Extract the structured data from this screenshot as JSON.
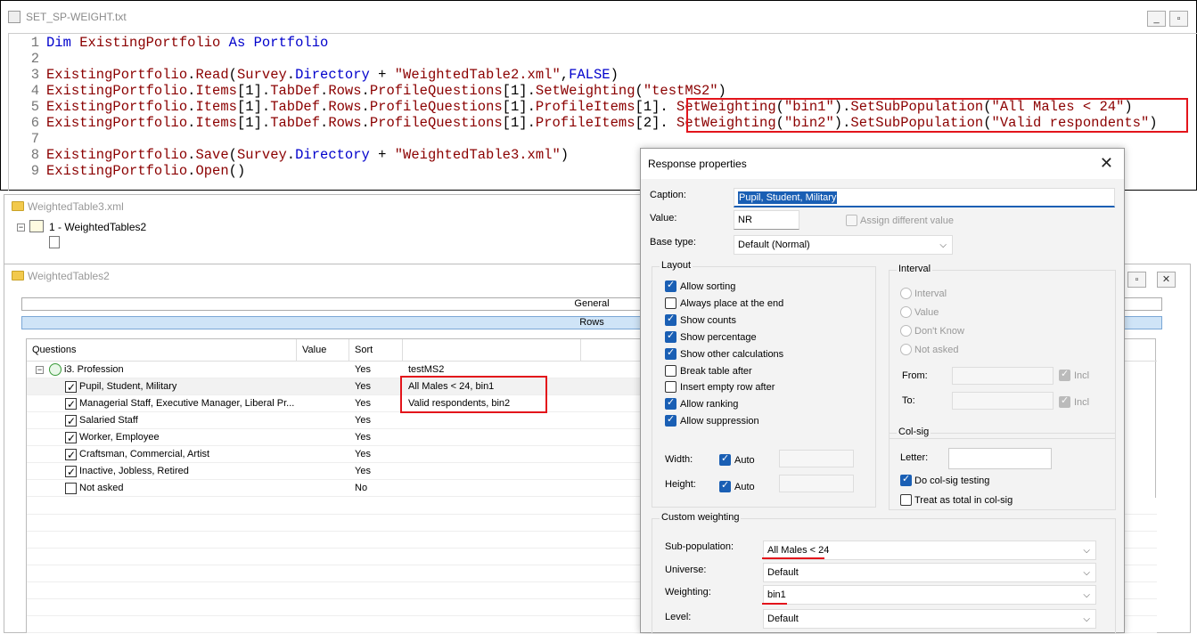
{
  "editor": {
    "title": "SET_SP-WEIGHT.txt",
    "lines": [
      {
        "n": "1",
        "segs": [
          [
            "kw",
            "Dim "
          ],
          [
            "ob",
            "ExistingPortfolio"
          ],
          [
            "kw",
            " As "
          ],
          [
            "kw",
            "Portfolio"
          ]
        ]
      },
      {
        "n": "2",
        "segs": []
      },
      {
        "n": "3",
        "segs": [
          [
            "ob",
            "ExistingPortfolio"
          ],
          [
            "pl",
            "."
          ],
          [
            "ob",
            "Read"
          ],
          [
            "pl",
            "("
          ],
          [
            "ob",
            "Survey"
          ],
          [
            "pl",
            "."
          ],
          [
            "kw",
            "Directory"
          ],
          [
            "pl",
            " + "
          ],
          [
            "st",
            "\"WeightedTable2.xml\""
          ],
          [
            "pl",
            ","
          ],
          [
            "kw",
            "FALSE"
          ],
          [
            "pl",
            ")"
          ]
        ]
      },
      {
        "n": "4",
        "segs": [
          [
            "ob",
            "ExistingPortfolio"
          ],
          [
            "pl",
            "."
          ],
          [
            "ob",
            "Items"
          ],
          [
            "pl",
            "[1]."
          ],
          [
            "ob",
            "TabDef"
          ],
          [
            "pl",
            "."
          ],
          [
            "ob",
            "Rows"
          ],
          [
            "pl",
            "."
          ],
          [
            "ob",
            "ProfileQuestions"
          ],
          [
            "pl",
            "[1]."
          ],
          [
            "ob",
            "SetWeighting"
          ],
          [
            "pl",
            "("
          ],
          [
            "st",
            "\"testMS2\""
          ],
          [
            "pl",
            ")"
          ]
        ]
      },
      {
        "n": "5",
        "segs": [
          [
            "ob",
            "ExistingPortfolio"
          ],
          [
            "pl",
            "."
          ],
          [
            "ob",
            "Items"
          ],
          [
            "pl",
            "[1]."
          ],
          [
            "ob",
            "TabDef"
          ],
          [
            "pl",
            "."
          ],
          [
            "ob",
            "Rows"
          ],
          [
            "pl",
            "."
          ],
          [
            "ob",
            "ProfileQuestions"
          ],
          [
            "pl",
            "[1]."
          ],
          [
            "ob",
            "ProfileItems"
          ],
          [
            "pl",
            "[1]. "
          ],
          [
            "ob",
            "SetWeighting"
          ],
          [
            "pl",
            "("
          ],
          [
            "st",
            "\"bin1\""
          ],
          [
            "pl",
            ")."
          ],
          [
            "ob",
            "SetSubPopulation"
          ],
          [
            "pl",
            "("
          ],
          [
            "st",
            "\"All Males < 24\""
          ],
          [
            "pl",
            ")"
          ]
        ]
      },
      {
        "n": "6",
        "segs": [
          [
            "ob",
            "ExistingPortfolio"
          ],
          [
            "pl",
            "."
          ],
          [
            "ob",
            "Items"
          ],
          [
            "pl",
            "[1]."
          ],
          [
            "ob",
            "TabDef"
          ],
          [
            "pl",
            "."
          ],
          [
            "ob",
            "Rows"
          ],
          [
            "pl",
            "."
          ],
          [
            "ob",
            "ProfileQuestions"
          ],
          [
            "pl",
            "[1]."
          ],
          [
            "ob",
            "ProfileItems"
          ],
          [
            "pl",
            "[2]. "
          ],
          [
            "ob",
            "SetWeighting"
          ],
          [
            "pl",
            "("
          ],
          [
            "st",
            "\"bin2\""
          ],
          [
            "pl",
            ")."
          ],
          [
            "ob",
            "SetSubPopulation"
          ],
          [
            "pl",
            "("
          ],
          [
            "st",
            "\"Valid respondents\""
          ],
          [
            "pl",
            ")"
          ]
        ]
      },
      {
        "n": "7",
        "segs": []
      },
      {
        "n": "8",
        "segs": [
          [
            "ob",
            "ExistingPortfolio"
          ],
          [
            "pl",
            "."
          ],
          [
            "ob",
            "Save"
          ],
          [
            "pl",
            "("
          ],
          [
            "ob",
            "Survey"
          ],
          [
            "pl",
            "."
          ],
          [
            "kw",
            "Directory"
          ],
          [
            "pl",
            " + "
          ],
          [
            "st",
            "\"WeightedTable3.xml\""
          ],
          [
            "pl",
            ")"
          ]
        ]
      },
      {
        "n": "9",
        "segs": [
          [
            "ob",
            "ExistingPortfolio"
          ],
          [
            "pl",
            "."
          ],
          [
            "ob",
            "Open"
          ],
          [
            "pl",
            "()"
          ]
        ]
      }
    ]
  },
  "tree": {
    "title": "WeightedTable3.xml",
    "item": "1 - WeightedTables2"
  },
  "table_window": {
    "title": "WeightedTables2",
    "bar_general": "General",
    "bar_rows": "Rows",
    "columns": [
      "Questions",
      "Value",
      "Sort",
      ""
    ],
    "question": {
      "label": "i3. Profession",
      "sort": "Yes",
      "weight": "testMS2"
    },
    "rows": [
      {
        "label": "Pupil, Student, Military",
        "sort": "Yes",
        "weight": "All Males < 24, bin1",
        "checked": true
      },
      {
        "label": "Managerial Staff, Executive Manager, Liberal Pr...",
        "sort": "Yes",
        "weight": "Valid respondents, bin2",
        "checked": true
      },
      {
        "label": "Salaried Staff",
        "sort": "Yes",
        "weight": "",
        "checked": true
      },
      {
        "label": "Worker, Employee",
        "sort": "Yes",
        "weight": "",
        "checked": true
      },
      {
        "label": "Craftsman, Commercial, Artist",
        "sort": "Yes",
        "weight": "",
        "checked": true
      },
      {
        "label": "Inactive, Jobless, Retired",
        "sort": "Yes",
        "weight": "",
        "checked": true
      },
      {
        "label": "Not asked",
        "sort": "No",
        "weight": "",
        "checked": false
      }
    ]
  },
  "dialog": {
    "title": "Response properties",
    "caption_label": "Caption:",
    "caption_value": "Pupil, Student, Military",
    "value_label": "Value:",
    "value_value": "NR",
    "assign_label": "Assign different value",
    "basetype_label": "Base type:",
    "basetype_value": "Default (Normal)",
    "layout_title": "Layout",
    "layout_items": [
      {
        "label": "Allow sorting",
        "on": true
      },
      {
        "label": "Always place at the end",
        "on": false
      },
      {
        "label": "Show counts",
        "on": true
      },
      {
        "label": "Show percentage",
        "on": true
      },
      {
        "label": "Show other calculations",
        "on": true
      },
      {
        "label": "Break table after",
        "on": false
      },
      {
        "label": "Insert empty row after",
        "on": false
      },
      {
        "label": "Allow ranking",
        "on": true
      },
      {
        "label": "Allow suppression",
        "on": true
      }
    ],
    "width_label": "Width:",
    "height_label": "Height:",
    "auto_label": "Auto",
    "interval_title": "Interval",
    "interval_items": [
      "Interval",
      "Value",
      "Don't Know",
      "Not asked"
    ],
    "from_label": "From:",
    "to_label": "To:",
    "incl_label": "Incl",
    "colsig_title": "Col-sig",
    "letter_label": "Letter:",
    "do_colsig": "Do col-sig testing",
    "treat_total": "Treat as total in col-sig",
    "custom_title": "Custom weighting",
    "subpop_label": "Sub-population:",
    "subpop_value": "All Males < 24",
    "universe_label": "Universe:",
    "universe_value": "Default",
    "weighting_label": "Weighting:",
    "weighting_value": "bin1",
    "level_label": "Level:",
    "level_value": "Default"
  }
}
